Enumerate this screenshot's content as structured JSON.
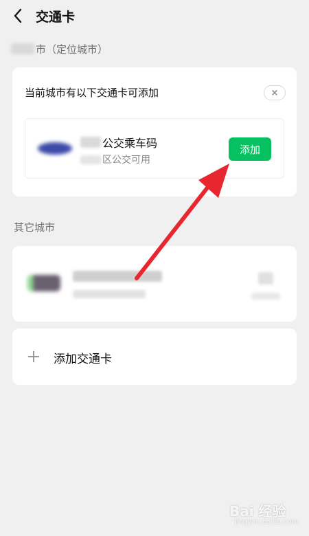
{
  "header": {
    "title": "交通卡",
    "back_icon": "chevron-left-icon"
  },
  "location": {
    "suffix": "市（定位城市）"
  },
  "current_city": {
    "heading": "当前城市有以下交通卡可添加",
    "close_label": "×",
    "card": {
      "name_suffix": "公交乘车码",
      "sub_suffix": "区公交可用",
      "add_label": "添加"
    }
  },
  "other_cities": {
    "label": "其它城市"
  },
  "add_card": {
    "label": "添加交通卡"
  },
  "colors": {
    "accent": "#07c160",
    "arrow": "#e8262f"
  },
  "watermark": {
    "main": "Bai 经验",
    "sub": "jingyan.baidu.com"
  }
}
